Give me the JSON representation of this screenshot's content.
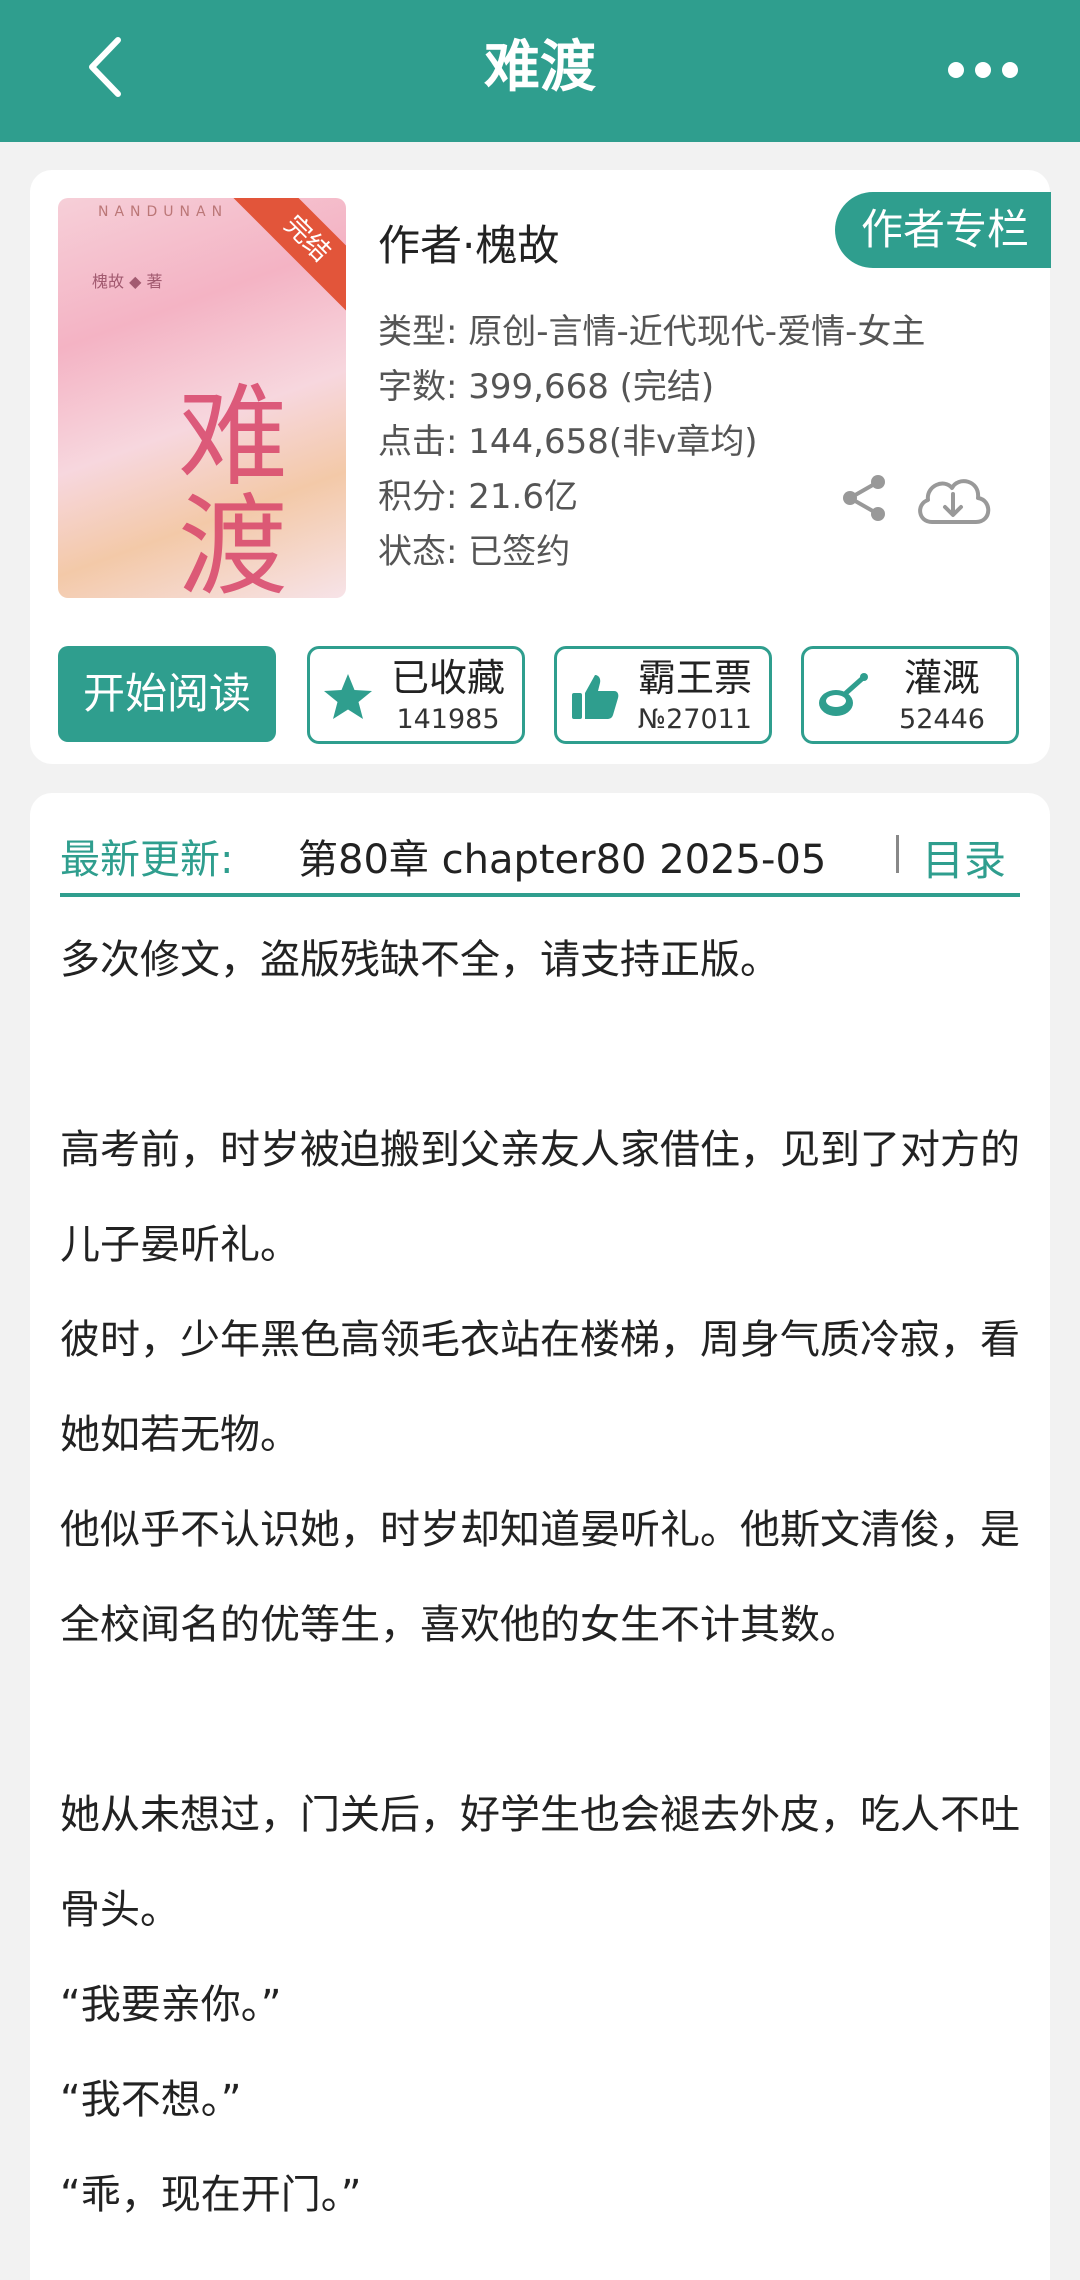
{
  "header": {
    "title": "难渡",
    "back_icon": "chevron-left-icon",
    "more_icon": "more-horizontal-icon"
  },
  "book": {
    "cover_ribbon": "完结",
    "cover_title": "难渡",
    "author_line": "作者·槐故",
    "author_column_button": "作者专栏",
    "meta": {
      "genre": "类型: 原创-言情-近代现代-爱情-女主",
      "word_count": "字数: 399,668 (完结)",
      "clicks": "点击: 144,658(非v章均)",
      "points": "积分: 21.6亿",
      "status": "状态: 已签约"
    }
  },
  "actions": {
    "start_reading": "开始阅读",
    "bookmark": {
      "label": "已收藏",
      "count": "141985",
      "icon": "star-icon"
    },
    "vote": {
      "label": "霸王票",
      "count": "№27011",
      "icon": "thumbs-up-icon"
    },
    "water": {
      "label": "灌溉",
      "count": "52446",
      "icon": "watering-can-icon"
    }
  },
  "update": {
    "label": "最新更新:",
    "value": "第80章  chapter80  2025-05",
    "toc": "目录"
  },
  "description": [
    "多次修文，盗版残缺不全，请支持正版。",
    "",
    "高考前，时岁被迫搬到父亲友人家借住，见到了对方的儿子晏听礼。",
    "彼时，少年黑色高领毛衣站在楼梯，周身气质冷寂，看她如若无物。",
    "他似乎不认识她，时岁却知道晏听礼。他斯文清俊，是全校闻名的优等生，喜欢他的女生不计其数。",
    "她从未想过，门关后，好学生也会褪去外皮，吃人不吐骨头。",
    "“我要亲你。”",
    "“我不想。”",
    "“乖，现在开门。”"
  ],
  "colors": {
    "brand": "#2f9e8e",
    "ribbon": "#e2553a"
  }
}
